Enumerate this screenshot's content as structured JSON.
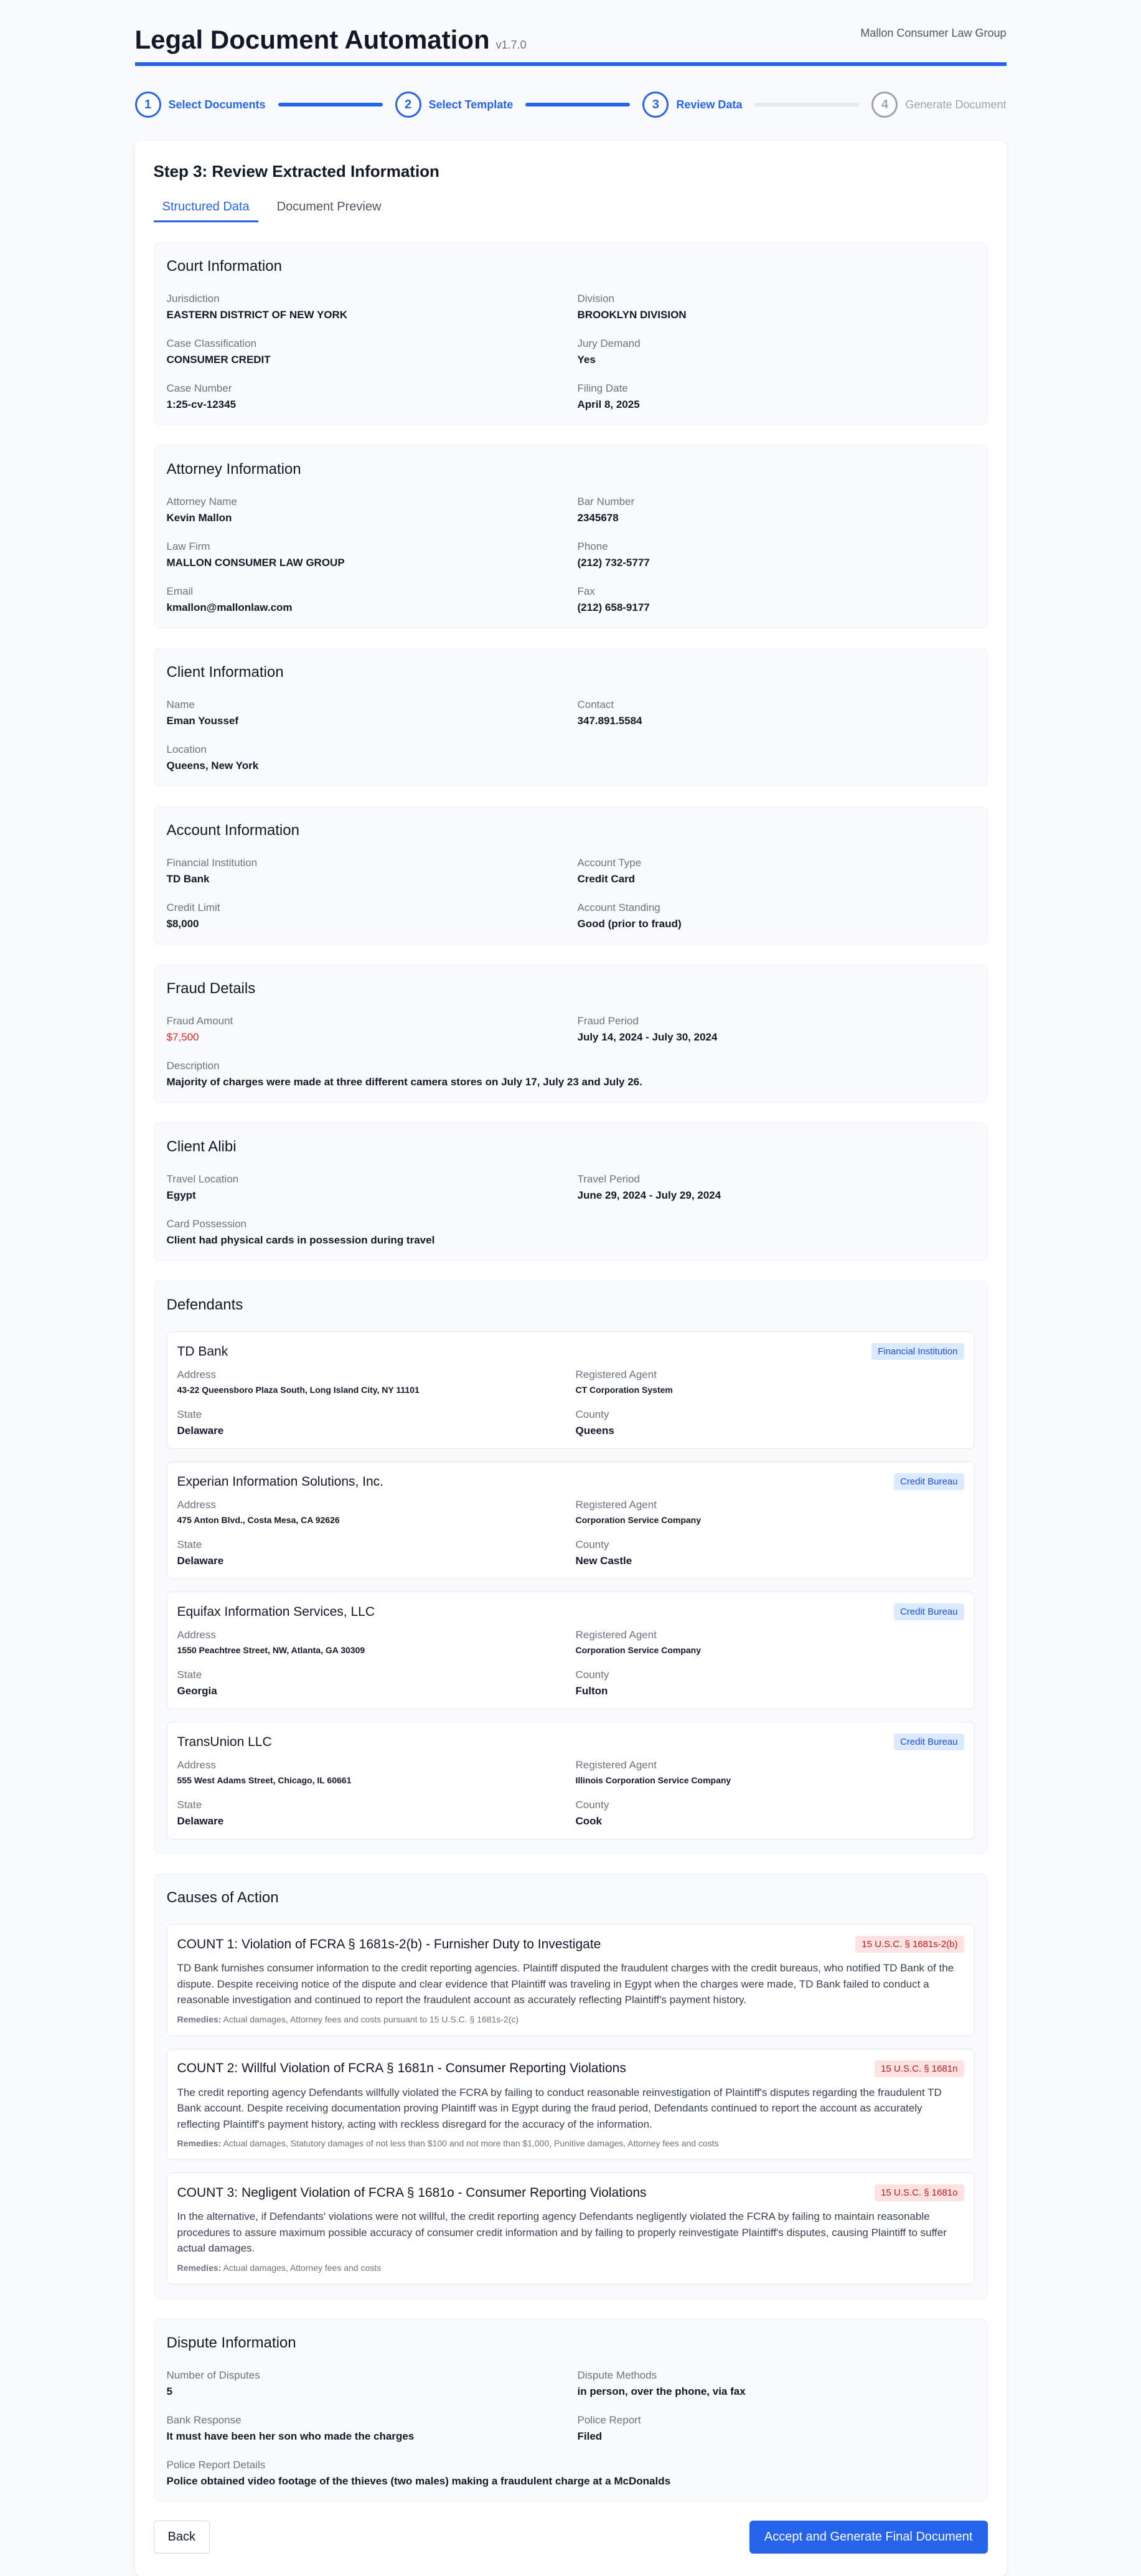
{
  "header": {
    "title": "Legal Document Automation",
    "version": "v1.7.0",
    "firm": "Mallon Consumer Law Group"
  },
  "stepper": [
    {
      "number": "1",
      "label": "Select Documents",
      "state": "complete"
    },
    {
      "number": "2",
      "label": "Select Template",
      "state": "complete"
    },
    {
      "number": "3",
      "label": "Review Data",
      "state": "current"
    },
    {
      "number": "4",
      "label": "Generate Document",
      "state": "inactive"
    }
  ],
  "card": {
    "title": "Step 3: Review Extracted Information",
    "tabs": {
      "structured": "Structured Data",
      "preview": "Document Preview"
    }
  },
  "court": {
    "title": "Court Information",
    "jurisdiction_label": "Jurisdiction",
    "jurisdiction": "EASTERN DISTRICT OF NEW YORK",
    "division_label": "Division",
    "division": "BROOKLYN DIVISION",
    "classification_label": "Case Classification",
    "classification": "CONSUMER CREDIT",
    "jury_label": "Jury Demand",
    "jury": "Yes",
    "case_label": "Case Number",
    "case": "1:25-cv-12345",
    "filing_label": "Filing Date",
    "filing": "April 8, 2025"
  },
  "attorney": {
    "title": "Attorney Information",
    "name_label": "Attorney Name",
    "name": "Kevin Mallon",
    "bar_label": "Bar Number",
    "bar": "2345678",
    "firm_label": "Law Firm",
    "firm": "MALLON CONSUMER LAW GROUP",
    "phone_label": "Phone",
    "phone": "(212) 732-5777",
    "email_label": "Email",
    "email": "kmallon@mallonlaw.com",
    "fax_label": "Fax",
    "fax": "(212) 658-9177"
  },
  "client": {
    "title": "Client Information",
    "name_label": "Name",
    "name": "Eman Youssef",
    "contact_label": "Contact",
    "contact": "347.891.5584",
    "location_label": "Location",
    "location": "Queens, New York"
  },
  "account": {
    "title": "Account Information",
    "institution_label": "Financial Institution",
    "institution": "TD Bank",
    "type_label": "Account Type",
    "type": "Credit Card",
    "limit_label": "Credit Limit",
    "limit": "$8,000",
    "standing_label": "Account Standing",
    "standing": "Good (prior to fraud)"
  },
  "fraud": {
    "title": "Fraud Details",
    "amount_label": "Fraud Amount",
    "amount": "$7,500",
    "period_label": "Fraud Period",
    "period": "July 14, 2024 - July 30, 2024",
    "description_label": "Description",
    "description": "Majority of charges were made at three different camera stores on July 17, July 23 and July 26."
  },
  "alibi": {
    "title": "Client Alibi",
    "location_label": "Travel Location",
    "location": "Egypt",
    "period_label": "Travel Period",
    "period": "June 29, 2024 - July 29, 2024",
    "possession_label": "Card Possession",
    "possession": "Client had physical cards in possession during travel"
  },
  "defendants": {
    "title": "Defendants",
    "labels": {
      "address": "Address",
      "agent": "Registered Agent",
      "state": "State",
      "county": "County"
    },
    "items": [
      {
        "name": "TD Bank",
        "badge": "Financial Institution",
        "address": "43-22 Queensboro Plaza South, Long Island City, NY 11101",
        "agent": "CT Corporation System",
        "state": "Delaware",
        "county": "Queens"
      },
      {
        "name": "Experian Information Solutions, Inc.",
        "badge": "Credit Bureau",
        "address": "475 Anton Blvd., Costa Mesa, CA 92626",
        "agent": "Corporation Service Company",
        "state": "Delaware",
        "county": "New Castle"
      },
      {
        "name": "Equifax Information Services, LLC",
        "badge": "Credit Bureau",
        "address": "1550 Peachtree Street, NW, Atlanta, GA 30309",
        "agent": "Corporation Service Company",
        "state": "Georgia",
        "county": "Fulton"
      },
      {
        "name": "TransUnion LLC",
        "badge": "Credit Bureau",
        "address": "555 West Adams Street, Chicago, IL 60661",
        "agent": "Illinois Corporation Service Company",
        "state": "Delaware",
        "county": "Cook"
      }
    ]
  },
  "causes": {
    "title": "Causes of Action",
    "remedies_label": "Remedies:",
    "items": [
      {
        "title": "COUNT 1: Violation of FCRA § 1681s-2(b) - Furnisher Duty to Investigate",
        "badge": "15 U.S.C. § 1681s-2(b)",
        "description": "TD Bank furnishes consumer information to the credit reporting agencies. Plaintiff disputed the fraudulent charges with the credit bureaus, who notified TD Bank of the dispute. Despite receiving notice of the dispute and clear evidence that Plaintiff was traveling in Egypt when the charges were made, TD Bank failed to conduct a reasonable investigation and continued to report the fraudulent account as accurately reflecting Plaintiff's payment history.",
        "remedies": "Actual damages, Attorney fees and costs pursuant to 15 U.S.C. § 1681s-2(c)"
      },
      {
        "title": "COUNT 2: Willful Violation of FCRA § 1681n - Consumer Reporting Violations",
        "badge": "15 U.S.C. § 1681n",
        "description": "The credit reporting agency Defendants willfully violated the FCRA by failing to conduct reasonable reinvestigation of Plaintiff's disputes regarding the fraudulent TD Bank account. Despite receiving documentation proving Plaintiff was in Egypt during the fraud period, Defendants continued to report the account as accurately reflecting Plaintiff's payment history, acting with reckless disregard for the accuracy of the information.",
        "remedies": "Actual damages, Statutory damages of not less than $100 and not more than $1,000, Punitive damages, Attorney fees and costs"
      },
      {
        "title": "COUNT 3: Negligent Violation of FCRA § 1681o - Consumer Reporting Violations",
        "badge": "15 U.S.C. § 1681o",
        "description": "In the alternative, if Defendants' violations were not willful, the credit reporting agency Defendants negligently violated the FCRA by failing to maintain reasonable procedures to assure maximum possible accuracy of consumer credit information and by failing to properly reinvestigate Plaintiff's disputes, causing Plaintiff to suffer actual damages.",
        "remedies": "Actual damages, Attorney fees and costs"
      }
    ]
  },
  "dispute": {
    "title": "Dispute Information",
    "number_label": "Number of Disputes",
    "number": "5",
    "methods_label": "Dispute Methods",
    "methods": "in person, over the phone, via fax",
    "bank_label": "Bank Response",
    "bank": "It must have been her son who made the charges",
    "police_label": "Police Report",
    "police": "Filed",
    "details_label": "Police Report Details",
    "details": "Police obtained video footage of the thieves (two males) making a fraudulent charge at a McDonalds"
  },
  "footer": {
    "back": "Back",
    "generate": "Accept and Generate Final Document"
  },
  "colors": {
    "accent": "#2563eb",
    "danger": "#dc2626"
  }
}
